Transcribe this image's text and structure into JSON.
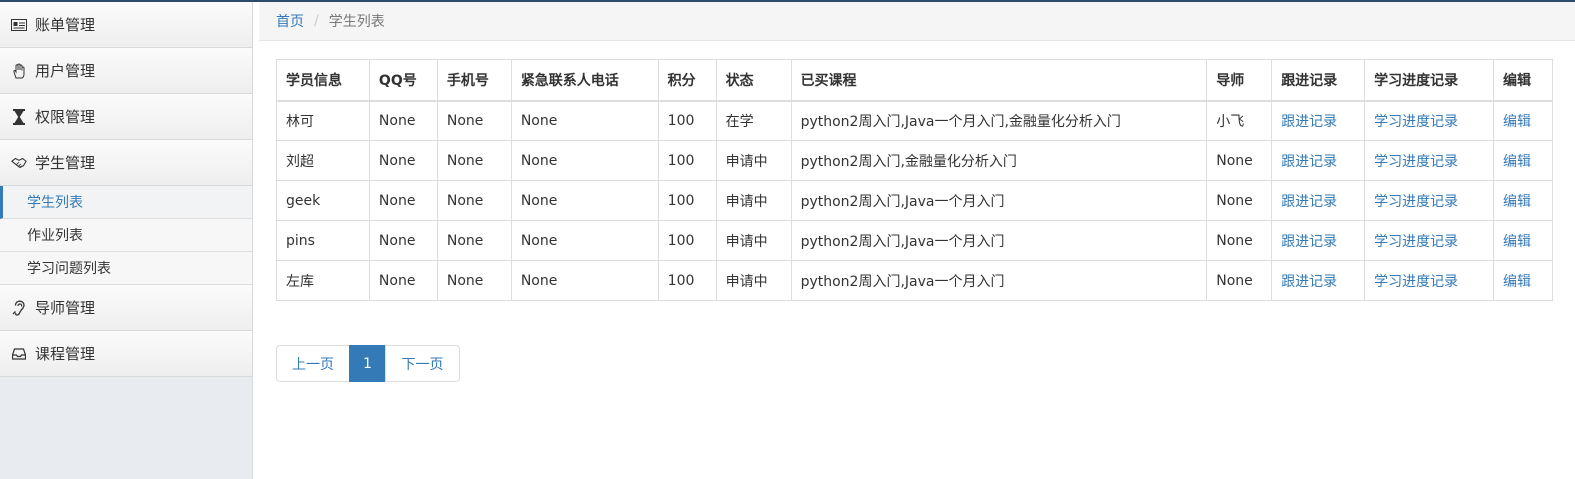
{
  "sidebar": {
    "menus": [
      {
        "label": "账单管理",
        "icon": "id-card-icon"
      },
      {
        "label": "用户管理",
        "icon": "hand-icon"
      },
      {
        "label": "权限管理",
        "icon": "hourglass-icon"
      },
      {
        "label": "学生管理",
        "icon": "handshake-icon"
      },
      {
        "label": "导师管理",
        "icon": "ear-icon"
      },
      {
        "label": "课程管理",
        "icon": "inbox-icon"
      }
    ],
    "student_sub": [
      "学生列表",
      "作业列表",
      "学习问题列表"
    ]
  },
  "breadcrumb": {
    "home": "首页",
    "separator": "/",
    "current": "学生列表"
  },
  "table": {
    "headers": [
      "学员信息",
      "QQ号",
      "手机号",
      "紧急联系人电话",
      "积分",
      "状态",
      "已买课程",
      "导师",
      "跟进记录",
      "学习进度记录",
      "编辑"
    ],
    "rows": [
      [
        "林可",
        "None",
        "None",
        "None",
        "100",
        "在学",
        "python2周入门,Java一个月入门,金融量化分析入门",
        "小飞",
        "跟进记录",
        "学习进度记录",
        "编辑"
      ],
      [
        "刘超",
        "None",
        "None",
        "None",
        "100",
        "申请中",
        "python2周入门,金融量化分析入门",
        "None",
        "跟进记录",
        "学习进度记录",
        "编辑"
      ],
      [
        "geek",
        "None",
        "None",
        "None",
        "100",
        "申请中",
        "python2周入门,Java一个月入门",
        "None",
        "跟进记录",
        "学习进度记录",
        "编辑"
      ],
      [
        "pins",
        "None",
        "None",
        "None",
        "100",
        "申请中",
        "python2周入门,Java一个月入门",
        "None",
        "跟进记录",
        "学习进度记录",
        "编辑"
      ],
      [
        "左库",
        "None",
        "None",
        "None",
        "100",
        "申请中",
        "python2周入门,Java一个月入门",
        "None",
        "跟进记录",
        "学习进度记录",
        "编辑"
      ]
    ]
  },
  "pagination": {
    "prev": "上一页",
    "current": "1",
    "next": "下一页"
  },
  "colors": {
    "link": "#337ab7",
    "topline": "#2b4a6e",
    "sidebar_bg": "#e8ecf0"
  }
}
